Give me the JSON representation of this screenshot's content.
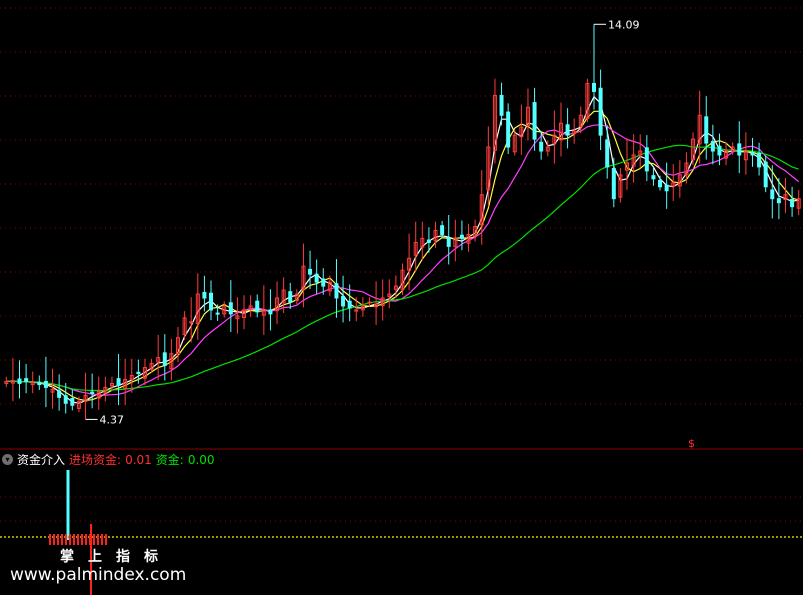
{
  "indicator": {
    "name": "资金介入",
    "fields": [
      {
        "label": "进场资金:",
        "value": "0.01",
        "color": "#ff3030"
      },
      {
        "label": "资金:",
        "value": "0.00",
        "color": "#00e000"
      }
    ]
  },
  "price_panel": {
    "high_label": "14.09",
    "low_label": "4.37",
    "signal_mark": "$"
  },
  "watermark": {
    "url": "www.palmindex.com",
    "chars": [
      "掌",
      "上",
      "指",
      "标"
    ]
  },
  "colors": {
    "up": "#ff3c3c",
    "down": "#54ffff",
    "ma_white": "#ffffff",
    "ma_yellow": "#ffff40",
    "ma_magenta": "#ff40ff",
    "ma_green": "#00e000",
    "grid": "#8b0000"
  },
  "chart_data": [
    {
      "type": "candlestick",
      "ylim": [
        3.5,
        14.5
      ],
      "close": [
        5.1,
        5.12,
        5.05,
        5.1,
        5.08,
        5.02,
        4.95,
        4.9,
        4.7,
        4.55,
        4.5,
        4.6,
        4.75,
        4.8,
        4.85,
        4.95,
        5.05,
        5.0,
        5.15,
        5.25,
        5.3,
        5.45,
        5.55,
        5.7,
        5.5,
        5.8,
        6.2,
        6.7,
        6.6,
        7.3,
        7.2,
        6.9,
        6.8,
        7.0,
        6.8,
        6.75,
        6.9,
        7.0,
        6.85,
        6.9,
        6.8,
        7.2,
        7.4,
        7.1,
        7.3,
        8.0,
        7.8,
        7.6,
        7.5,
        7.6,
        7.2,
        7.0,
        6.95,
        6.9,
        7.0,
        7.1,
        7.05,
        7.2,
        7.3,
        7.5,
        7.9,
        8.2,
        8.6,
        8.7,
        8.6,
        8.9,
        8.8,
        8.5,
        8.7,
        8.7,
        8.8,
        9.0,
        9.8,
        11.0,
        12.3,
        11.8,
        11.0,
        11.3,
        11.5,
        12.0,
        11.2,
        10.9,
        11.0,
        11.3,
        11.6,
        11.3,
        11.4,
        11.8,
        12.6,
        12.4,
        11.3,
        10.5,
        9.7,
        10.3,
        10.6,
        10.8,
        10.9,
        10.4,
        10.2,
        10.0,
        9.9,
        10.1,
        10.3,
        10.6,
        11.2,
        11.8,
        11.1,
        10.9,
        10.8,
        10.9,
        11.0,
        10.8,
        10.9,
        10.8,
        10.5,
        10.0,
        9.7,
        9.6,
        9.8,
        9.5,
        9.7
      ],
      "ma_periods_drawn": [
        "white",
        "yellow",
        "magenta",
        "green"
      ],
      "annotations": [
        {
          "text": "14.09",
          "type": "max"
        },
        {
          "text": "4.37",
          "type": "min"
        }
      ]
    },
    {
      "type": "bar",
      "title": "资金介入",
      "series": [
        {
          "name": "进场资金",
          "value": 0.01
        },
        {
          "name": "资金",
          "value": 0.0
        }
      ]
    }
  ]
}
